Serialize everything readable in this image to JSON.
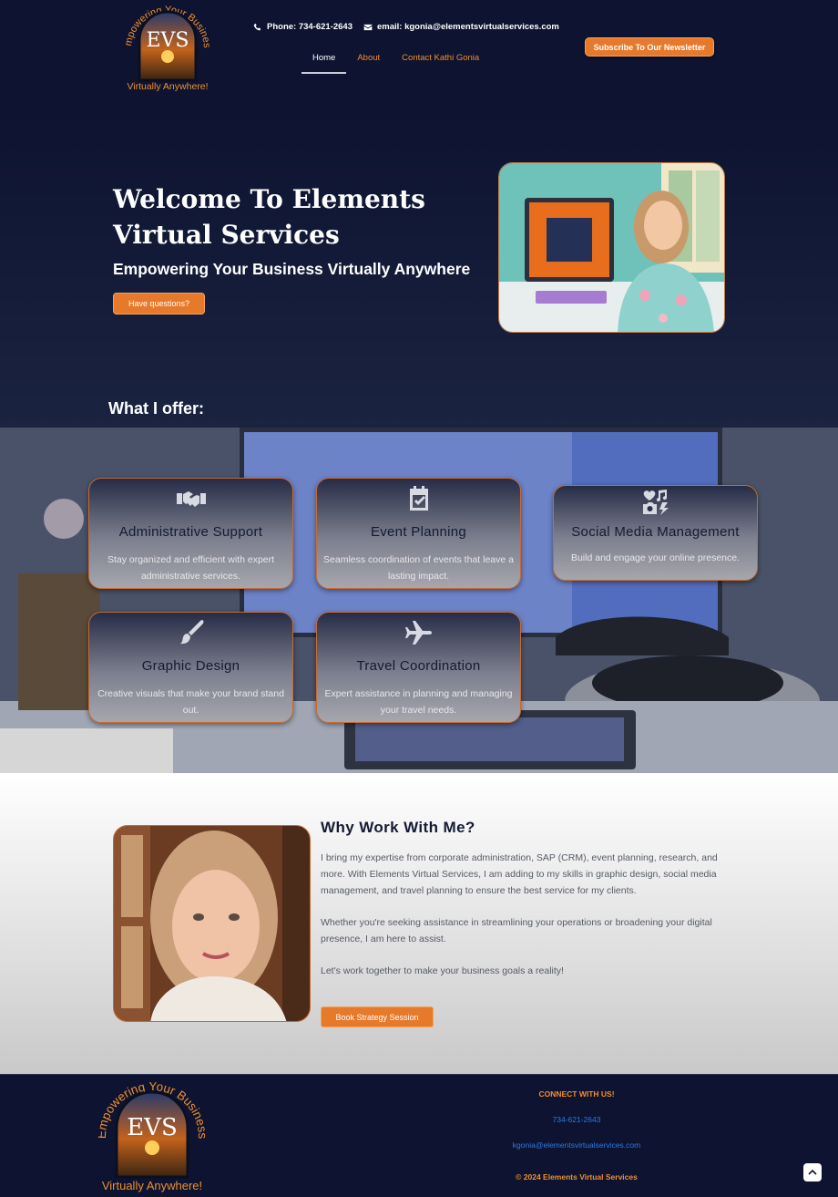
{
  "header": {
    "logo": {
      "arc_text": "Empowering Your Business",
      "monogram": "EVS",
      "tagline": "Virtually Anywhere!"
    },
    "phone_label": "Phone: 734-621-2643",
    "email_label": "email: kgonia@elementsvirtualservices.com",
    "nav": [
      {
        "label": "Home",
        "active": true
      },
      {
        "label": "About",
        "active": false
      },
      {
        "label": "Contact Kathi Gonia",
        "active": false
      }
    ],
    "subscribe_label": "Subscribe To Our Newsletter"
  },
  "hero": {
    "title": "Welcome To Elements Virtual Services",
    "subtitle": "Empowering Your Business Virtually Anywhere",
    "button_label": "Have questions?"
  },
  "services": {
    "heading": "What I offer:",
    "items": [
      {
        "icon": "handshake-icon",
        "title": "Administrative Support",
        "description": "Stay organized and efficient with expert administrative services."
      },
      {
        "icon": "calendar-check-icon",
        "title": "Event Planning",
        "description": "Seamless coordination of events that leave a lasting impact."
      },
      {
        "icon": "social-media-icon",
        "title": "Social Media Management",
        "description": "Build and engage your online presence."
      },
      {
        "icon": "paintbrush-icon",
        "title": "Graphic Design",
        "description": "Creative visuals that make your brand stand out."
      },
      {
        "icon": "airplane-icon",
        "title": "Travel Coordination",
        "description": "Expert assistance in planning and managing your travel needs."
      }
    ]
  },
  "why": {
    "title": "Why Work With Me?",
    "paragraphs": [
      "I bring my expertise from corporate administration, SAP (CRM), event planning, research, and more. With Elements Virtual Services, I am adding to my skills in graphic design, social media management, and travel planning to ensure the best service for my clients.",
      "Whether you're seeking assistance in streamlining your operations or broadening your digital presence, I am here to assist.",
      "Let's work together to make your business goals a reality!"
    ],
    "button_label": "Book Strategy Session"
  },
  "footer": {
    "connect": "CONNECT WITH US!",
    "phone": "734-621-2643",
    "email": "kgonia@elementsvirtualservices.com",
    "copyright": "© 2024 Elements Virtual Services"
  },
  "colors": {
    "navy": "#0d1330",
    "orange": "#e7792b",
    "link_blue": "#2f7ae5"
  }
}
